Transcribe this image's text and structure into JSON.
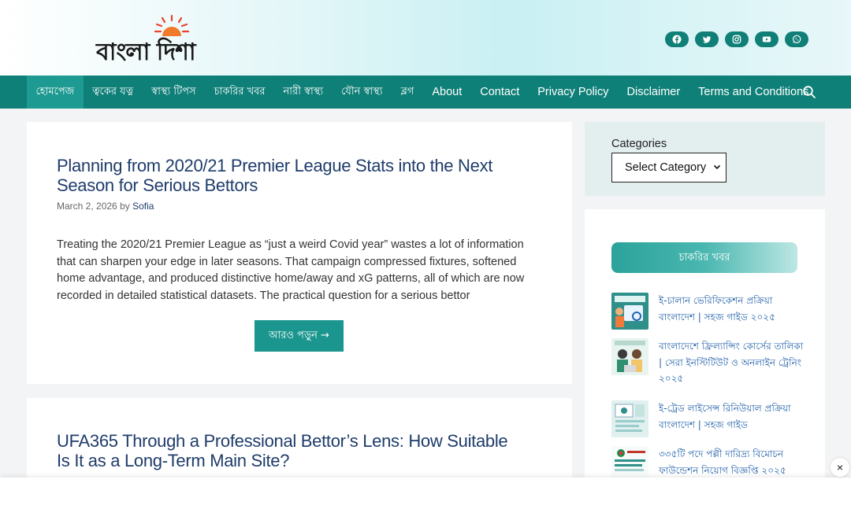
{
  "site": {
    "logo_text": "বাংলা দিশা"
  },
  "socials": [
    "facebook-icon",
    "twitter-icon",
    "instagram-icon",
    "youtube-icon",
    "whatsapp-icon"
  ],
  "nav": {
    "items": [
      {
        "label": "হোমপেজ",
        "bn": true,
        "active": true
      },
      {
        "label": "ত্বকের যত্ন",
        "bn": true
      },
      {
        "label": "স্বাস্থ্য টিপস",
        "bn": true
      },
      {
        "label": "চাকরির খবর",
        "bn": true
      },
      {
        "label": "নারী স্বাস্থ্য",
        "bn": true
      },
      {
        "label": "যৌন স্বাস্থ্য",
        "bn": true
      },
      {
        "label": "ব্লগ",
        "bn": true
      },
      {
        "label": "About"
      },
      {
        "label": "Contact"
      },
      {
        "label": "Privacy Policy"
      },
      {
        "label": "Disclaimer"
      },
      {
        "label": "Terms and Conditions"
      }
    ]
  },
  "posts": [
    {
      "title": "Planning from 2020/21 Premier League Stats into the Next Season for Serious Bettors",
      "date": "March 2, 2026",
      "by": "by",
      "author": "Sofia",
      "excerpt": "Treating the 2020/21 Premier League as “just a weird Covid year” wastes a lot of information that can sharpen your edge in later seasons. That campaign compressed fixtures, softened home advantage, and produced distinctive home/away and xG patterns, all of which are now recorded in detailed statistical datasets. The practical question for a serious bettor",
      "read_more": "আরও পড়ুন →"
    },
    {
      "title": "UFA365 Through a Professional Bettor’s Lens: How Suitable Is It as a Long-Term Main Site?"
    }
  ],
  "sidebar": {
    "categories_label": "Categories",
    "select_value": "Select Category",
    "jobs_heading": "চাকরির খবর",
    "jobs": [
      {
        "title": "ই-চালান ভেরিফিকেশন প্রক্রিয়া বাংলাদেশ | সহজ গাইড ২০২৫"
      },
      {
        "title": "বাংলাদেশে ফ্রিল্যান্সিং কোর্সের তালিকা | সেরা ইনস্টিটিউট ও অনলাইন ট্রেনিং ২০২৫"
      },
      {
        "title": "ই-ট্রেড লাইসেন্স রিনিউয়াল প্রক্রিয়া বাংলাদেশ | সহজ গাইড"
      },
      {
        "title": "৩৩৫টি পদে পল্লী দারিদ্র্য বিমোচন ফাউন্ডেশন নিয়োগ বিজ্ঞপ্তি ২০২৫"
      }
    ]
  },
  "overlay": {
    "close": "×"
  }
}
